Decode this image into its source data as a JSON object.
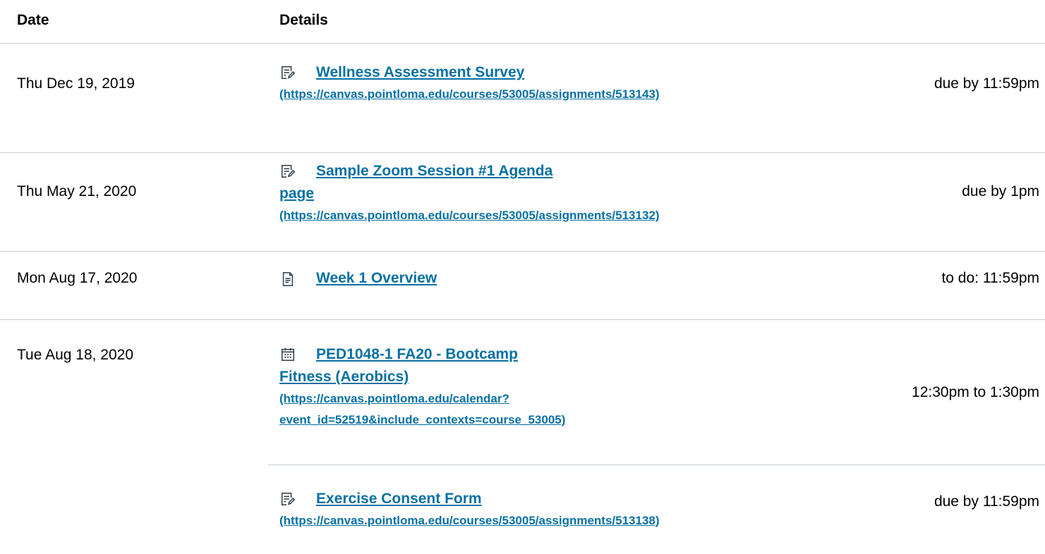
{
  "header": {
    "date_label": "Date",
    "details_label": "Details"
  },
  "rows": [
    {
      "date": "Thu Dec 19, 2019",
      "icon": "assignment-icon",
      "title": "Wellness Assessment Survey",
      "url": "(https://canvas.pointloma.edu/courses/53005/assignments/513143)",
      "due": "due by 11:59pm"
    },
    {
      "date": "Thu May 21, 2020",
      "icon": "assignment-icon",
      "title_line1": "Sample Zoom Session #1 Agenda",
      "title_line2": "page",
      "url": "(https://canvas.pointloma.edu/courses/53005/assignments/513132)",
      "due": "due by 1pm"
    },
    {
      "date": "Mon Aug 17, 2020",
      "icon": "page-icon",
      "title": "Week 1 Overview",
      "due": "to do: 11:59pm"
    },
    {
      "date": "Tue Aug 18, 2020",
      "icon": "calendar-icon",
      "title_line1": "PED1048-1 FA20 - Bootcamp",
      "title_line2": "Fitness (Aerobics)",
      "url_line1": "(https://canvas.pointloma.edu/calendar?",
      "url_line2": "event_id=52519&include_contexts=course_53005)",
      "due": "12:30pm to 1:30pm"
    },
    {
      "date": "",
      "icon": "assignment-icon",
      "title": "Exercise Consent Form",
      "url": "(https://canvas.pointloma.edu/courses/53005/assignments/513138)",
      "due": "due by 11:59pm"
    }
  ]
}
